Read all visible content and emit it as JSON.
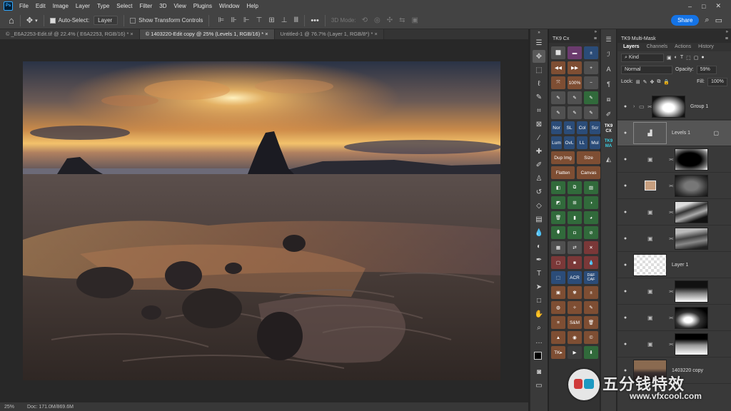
{
  "menubar": {
    "logo": "Ps",
    "items": [
      "File",
      "Edit",
      "Image",
      "Layer",
      "Type",
      "Select",
      "Filter",
      "3D",
      "View",
      "Plugins",
      "Window",
      "Help"
    ],
    "window_controls": [
      "–",
      "□",
      "✕"
    ]
  },
  "optionsbar": {
    "auto_select_label": "Auto-Select:",
    "auto_select_value": "Layer",
    "transform_label": "Show Transform Controls",
    "mode_label": "3D Mode:",
    "share_label": "Share"
  },
  "doc_tabs": [
    {
      "label": "© _E6A2253-Edit.tif @ 22.4% ( E6A2253, RGB/16) *",
      "active": false
    },
    {
      "label": "© 1403220-Edit copy @ 25% (Levels 1, RGB/16) *",
      "active": true
    },
    {
      "label": "Untitled-1 @ 76.7% (Layer 1, RGB/8*) *",
      "active": false
    }
  ],
  "status": {
    "zoom": "25%",
    "doc": "Doc: 171.0M/869.6M"
  },
  "tk9cx": {
    "title": "TK9 Cx",
    "row_nor": [
      "Nor",
      "SL",
      "Col",
      "Scr"
    ],
    "row_lum": [
      "Lum",
      "OvL",
      "LL",
      "Mul"
    ],
    "dup_img": "Dup Img",
    "size": "Size",
    "flatten": "Flatten",
    "canvas": "Canvas",
    "pct": "100%",
    "acr": "ACR",
    "dfcaf": "D&F CAF",
    "sm": "S&M",
    "tk": "TK▸"
  },
  "side_logos": {
    "cx": "TK9 CX",
    "ma": "TK9 MA"
  },
  "layers_panel": {
    "title": "TK9 Multi-Mask",
    "tabs": [
      "Layers",
      "Channels",
      "Actions",
      "History"
    ],
    "kind": "Kind",
    "blend_mode": "Normal",
    "opacity_label": "Opacity:",
    "opacity_value": "59%",
    "lock_label": "Lock:",
    "fill_label": "Fill:",
    "fill_value": "100%",
    "layers": [
      {
        "name": "Group 1"
      },
      {
        "name": "Levels 1"
      },
      {
        "name": ""
      },
      {
        "name": ""
      },
      {
        "name": ""
      },
      {
        "name": ""
      },
      {
        "name": "Layer 1"
      },
      {
        "name": ""
      },
      {
        "name": ""
      },
      {
        "name": ""
      },
      {
        "name": "1403220 copy"
      }
    ]
  },
  "watermark": {
    "text": "五分钱特效",
    "url": "www.vfxcool.com"
  }
}
